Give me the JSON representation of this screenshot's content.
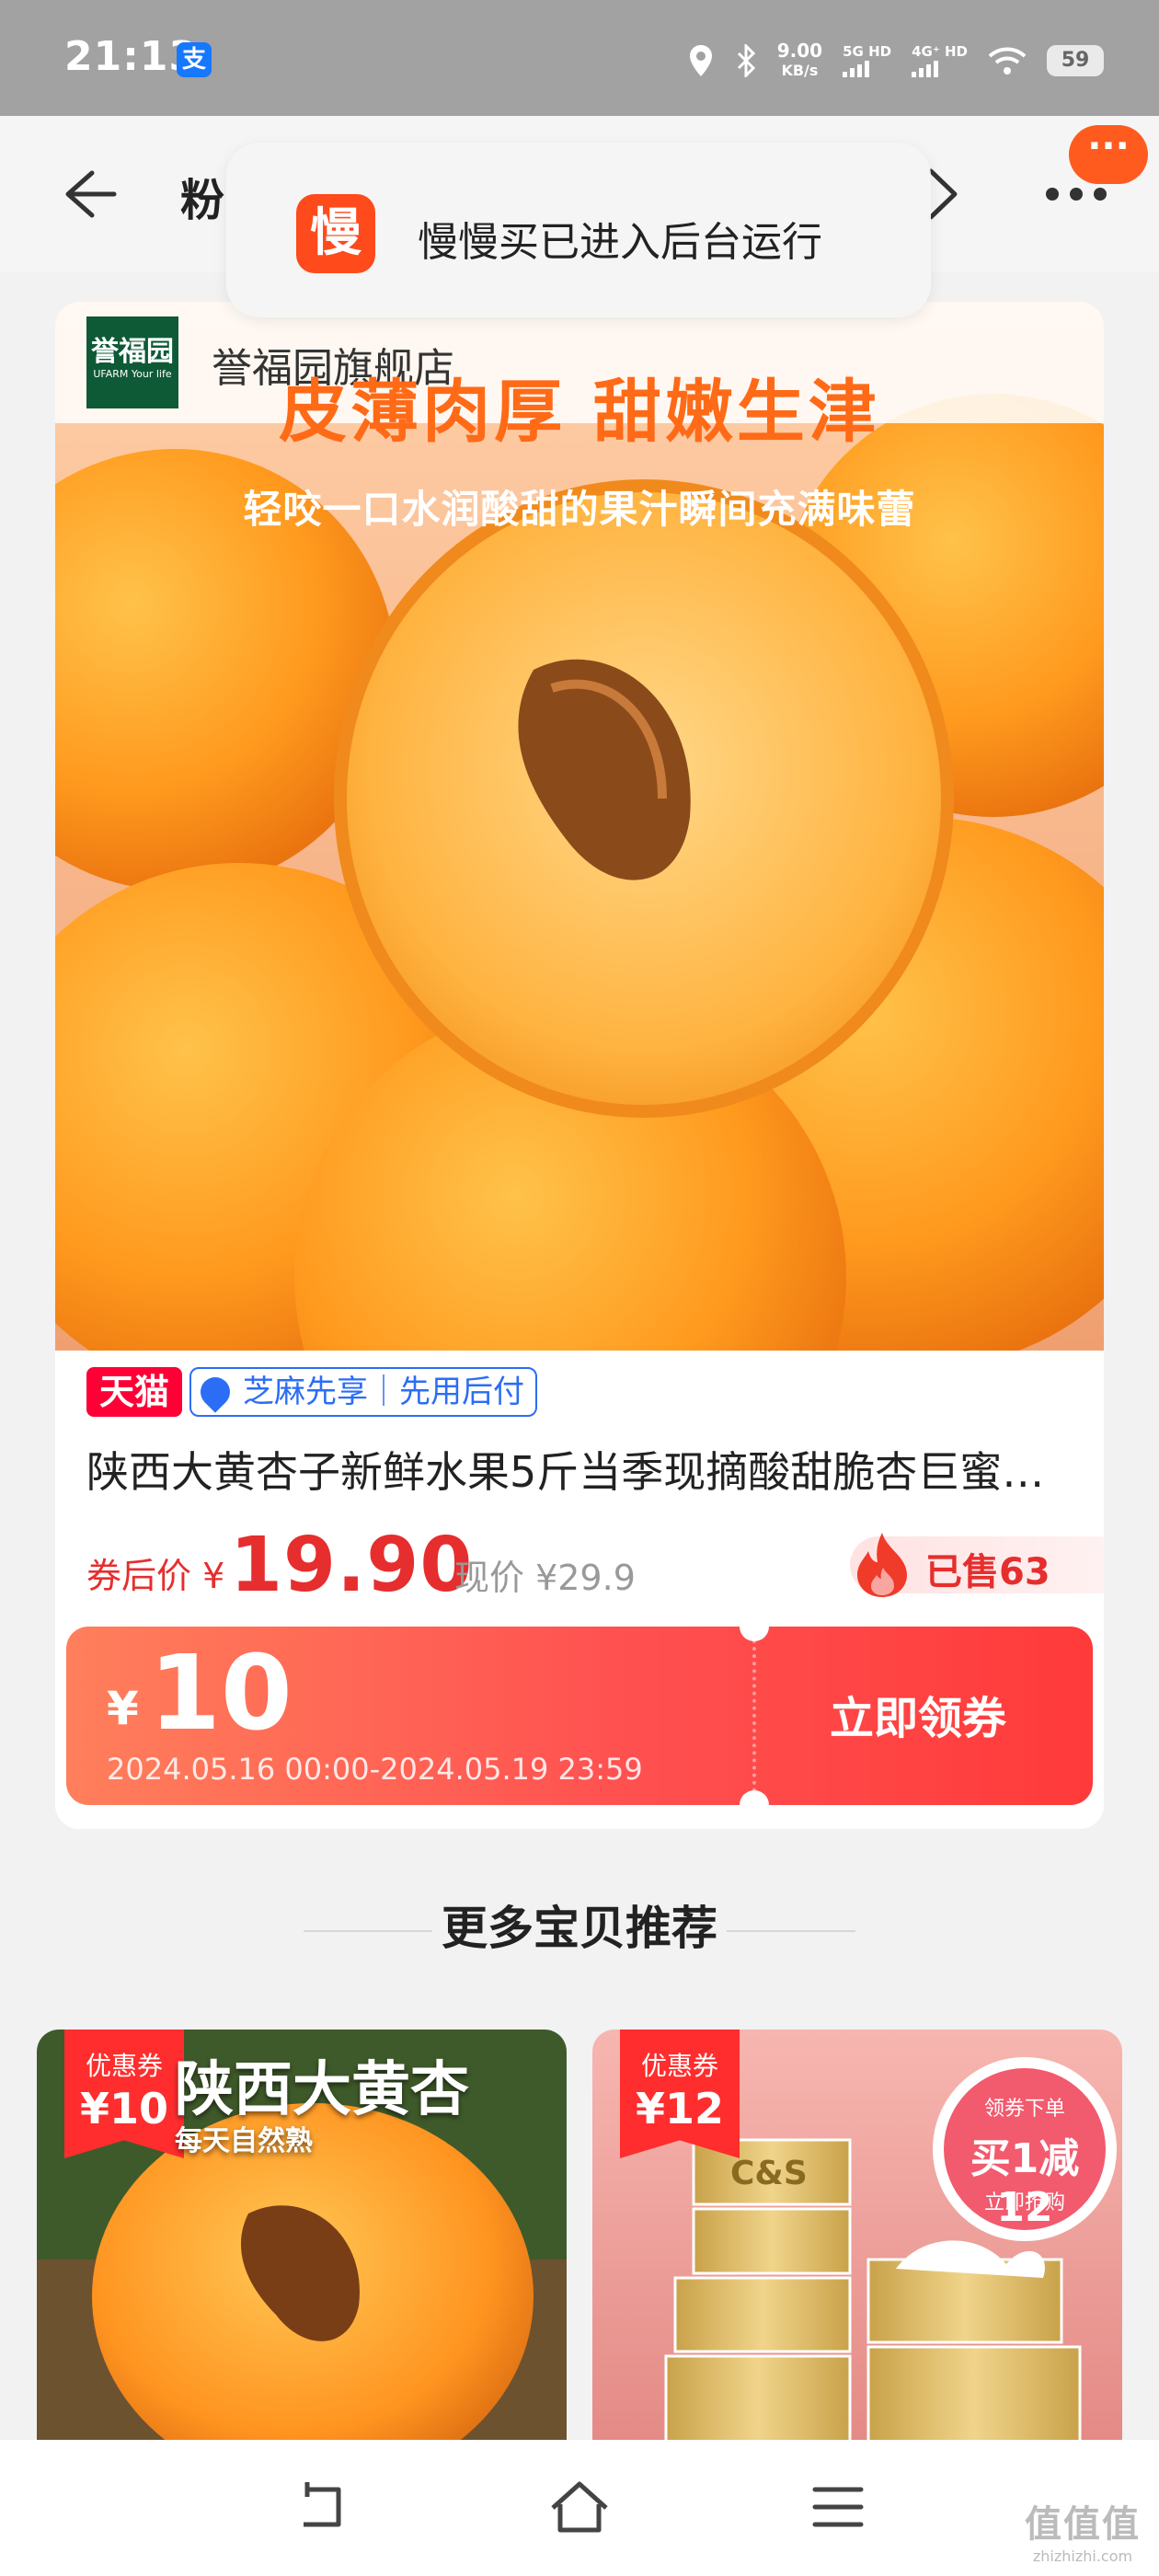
{
  "status_bar": {
    "time": "21:13",
    "alipay_badge": "支",
    "net_speed_value": "9.00",
    "net_speed_unit": "KB/s",
    "signal_1": "5G HD",
    "signal_2": "4G⁺ HD",
    "battery": "59"
  },
  "nav": {
    "title_partial": "粉",
    "message_badge": "···"
  },
  "toast": {
    "logo_char": "慢",
    "text": "慢慢买已进入后台运行"
  },
  "product": {
    "store_logo_text": "誉福园",
    "store_logo_sub": "UFARM Your life",
    "store_name": "誉福园旗舰店",
    "image_headline": "皮薄肉厚 甜嫩生津",
    "image_subline": "轻咬一口水润酸甜的果汁瞬间充满味蕾",
    "tmall_badge": "天猫",
    "zhima_badge": "芝麻先享｜先用后付",
    "title": "陕西大黄杏子新鲜水果5斤当季现摘酸甜脆杏巨蜜…",
    "price_label": "券后价 ¥",
    "price": "19.90",
    "original_price": "现价 ¥29.9",
    "sold": "已售63"
  },
  "coupon": {
    "currency": "¥",
    "amount": "10",
    "period": "2024.05.16 00:00-2024.05.19 23:59",
    "cta": "立即领券"
  },
  "recommend": {
    "heading": "更多宝贝推荐",
    "items": [
      {
        "coupon_label": "优惠券",
        "coupon_amount": "¥10",
        "image_title": "陕西大黄杏",
        "image_sub": "每天自然熟"
      },
      {
        "coupon_label": "优惠券",
        "coupon_amount": "¥12",
        "brand": "C&S",
        "promo_top": "领券下单",
        "promo": "买1减12",
        "promo_bottom": "立即抢购"
      }
    ]
  },
  "watermark": {
    "big": "值值值",
    "small": "zhizhizhi.com"
  },
  "colors": {
    "accent_red": "#e62e2e",
    "tmall_red": "#ff0036",
    "zhima_blue": "#2b6df5",
    "store_green": "#0e5a37",
    "app_orange": "#ff4a1c"
  }
}
